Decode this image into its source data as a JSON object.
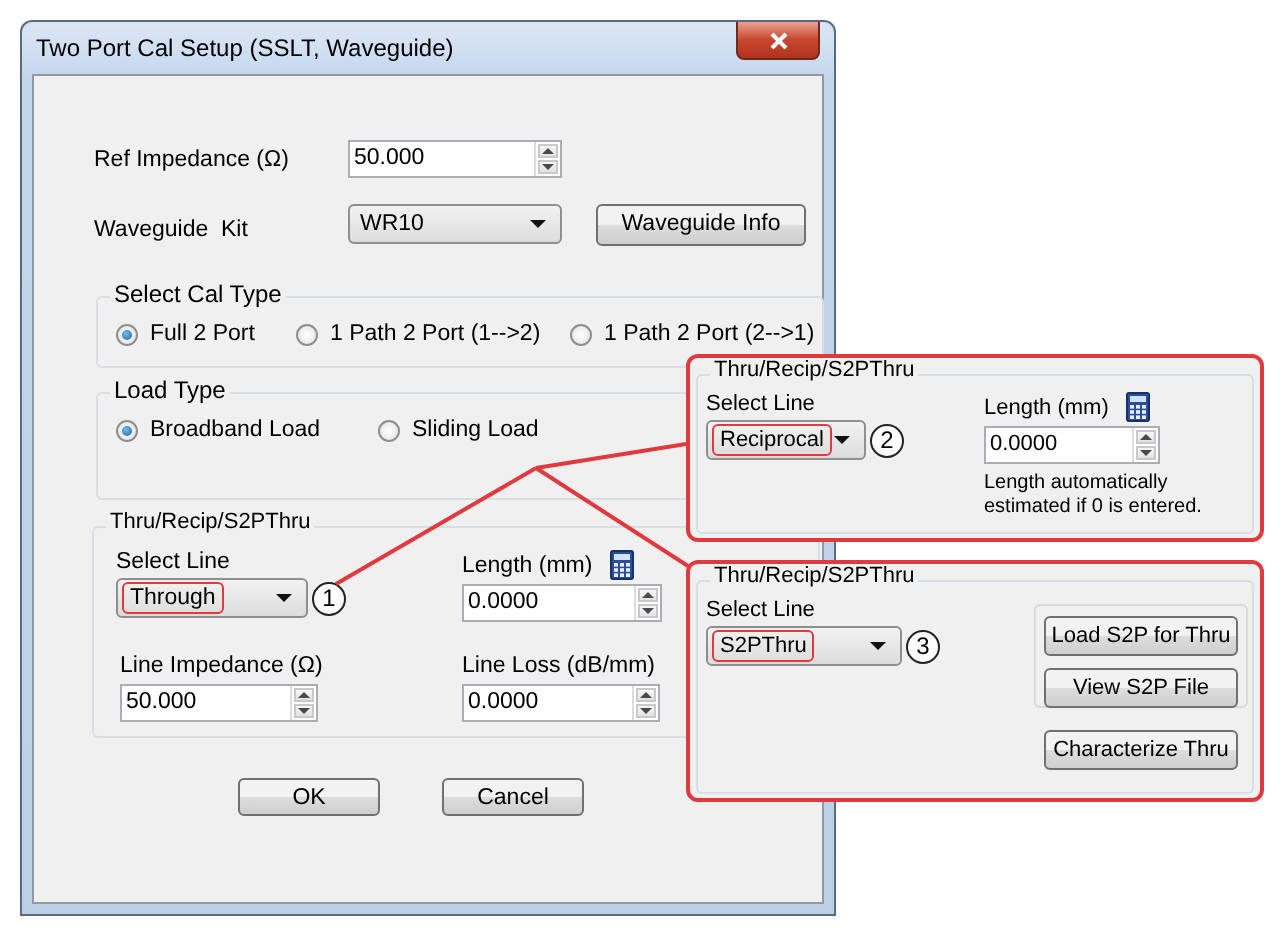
{
  "window": {
    "title": "Two Port Cal Setup (SSLT, Waveguide)"
  },
  "ref_impedance": {
    "label": "Ref Impedance (Ω)",
    "value": "50.000"
  },
  "waveguide_kit": {
    "label": "Waveguide  Kit",
    "value": "WR10",
    "button": "Waveguide Info"
  },
  "cal_type": {
    "title": "Select Cal Type",
    "options": [
      {
        "label": "Full 2 Port",
        "selected": true
      },
      {
        "label": "1 Path 2 Port (1-->2)",
        "selected": false
      },
      {
        "label": "1 Path 2 Port (2-->1)",
        "selected": false
      }
    ]
  },
  "load_type": {
    "title": "Load Type",
    "options": [
      {
        "label": "Broadband Load",
        "selected": true
      },
      {
        "label": "Sliding Load",
        "selected": false
      }
    ]
  },
  "thru": {
    "title": "Thru/Recip/S2PThru",
    "select_line": {
      "label": "Select Line",
      "value": "Through",
      "marker": "1"
    },
    "length": {
      "label": "Length (mm)",
      "value": "0.0000",
      "calculator": true
    },
    "line_impedance": {
      "label": "Line Impedance (Ω)",
      "value": "50.000"
    },
    "line_loss": {
      "label": "Line Loss (dB/mm)",
      "value": "0.0000"
    }
  },
  "buttons": [
    "OK",
    "Cancel"
  ],
  "callouts": [
    {
      "kind": "length",
      "title": "Thru/Recip/S2PThru",
      "select_line": {
        "label": "Select Line",
        "value": "Reciprocal",
        "marker": "2"
      },
      "length": {
        "label": "Length (mm)",
        "value": "0.0000",
        "calculator": true
      },
      "note": "Length automatically estimated if 0 is entered."
    },
    {
      "kind": "buttons",
      "title": "Thru/Recip/S2PThru",
      "select_line": {
        "label": "Select Line",
        "value": "S2PThru",
        "marker": "3"
      },
      "buttons": [
        "Load S2P for Thru",
        "View S2P File",
        "Characterize Thru"
      ]
    }
  ]
}
